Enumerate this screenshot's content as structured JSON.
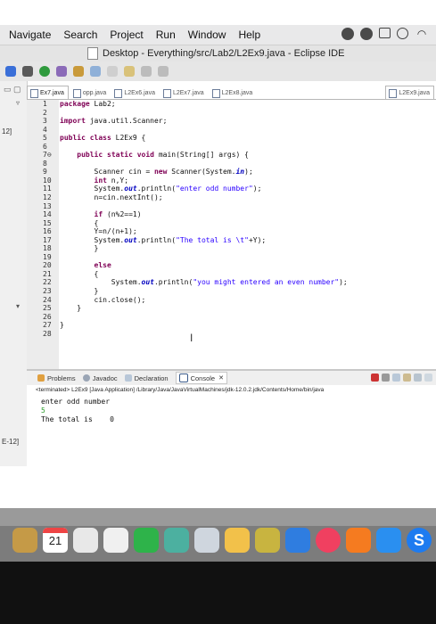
{
  "menubar": {
    "items": [
      "Navigate",
      "Search",
      "Project",
      "Run",
      "Window",
      "Help"
    ]
  },
  "window": {
    "title": "Desktop - Everything/src/Lab2/L2Ex9.java - Eclipse IDE"
  },
  "tabs": [
    "Ex7.java",
    "opp.java",
    "L2Ex6.java",
    "L2Ex7.java",
    "L2Ex8.java",
    "L2Ex9.java"
  ],
  "active_tab": "L2Ex9.java",
  "left_panel": {
    "label_top": "12]",
    "label_bottom": "E-12]"
  },
  "code": {
    "lines": [
      {
        "n": "1",
        "t": "package Lab2;"
      },
      {
        "n": "2",
        "t": ""
      },
      {
        "n": "3",
        "t": "import java.util.Scanner;"
      },
      {
        "n": "4",
        "t": ""
      },
      {
        "n": "5",
        "t": "public class L2Ex9 {"
      },
      {
        "n": "6",
        "t": ""
      },
      {
        "n": "7⊖",
        "t": "    public static void main(String[] args) {"
      },
      {
        "n": "8",
        "t": ""
      },
      {
        "n": "9",
        "t": "        Scanner cin = new Scanner(System.in);"
      },
      {
        "n": "10",
        "t": "        int n,Y;"
      },
      {
        "n": "11",
        "t": "        System.out.println(\"enter odd number\");"
      },
      {
        "n": "12",
        "t": "        n=cin.nextInt();"
      },
      {
        "n": "13",
        "t": ""
      },
      {
        "n": "14",
        "t": "        if (n%2==1)"
      },
      {
        "n": "15",
        "t": "        {"
      },
      {
        "n": "16",
        "t": "        Y=n/(n+1);"
      },
      {
        "n": "17",
        "t": "        System.out.println(\"The total is \\t\"+Y);"
      },
      {
        "n": "18",
        "t": "        }"
      },
      {
        "n": "19",
        "t": ""
      },
      {
        "n": "20",
        "t": "        else"
      },
      {
        "n": "21",
        "t": "        {"
      },
      {
        "n": "22",
        "t": "            System.out.println(\"you might entered an even number\");"
      },
      {
        "n": "23",
        "t": "        }"
      },
      {
        "n": "24",
        "t": "        cin.close();"
      },
      {
        "n": "25",
        "t": "    }"
      },
      {
        "n": "26",
        "t": ""
      },
      {
        "n": "27",
        "t": "}"
      },
      {
        "n": "28",
        "t": ""
      }
    ]
  },
  "console": {
    "tabs": [
      "Problems",
      "Javadoc",
      "Declaration",
      "Console"
    ],
    "terminated": "<terminated> L2Ex9 [Java Application] /Library/Java/JavaVirtualMachines/jdk-12.0.2.jdk/Contents/Home/bin/java",
    "output": [
      "enter odd number",
      "5",
      "The total is \t0"
    ]
  },
  "dock": {
    "calendar_day": "21",
    "last_icon_letter": "S"
  },
  "colors": {
    "keyword": "#7f0055",
    "string": "#2a00ff",
    "field": "#0000c0",
    "input_echo": "#2a9d2a"
  }
}
